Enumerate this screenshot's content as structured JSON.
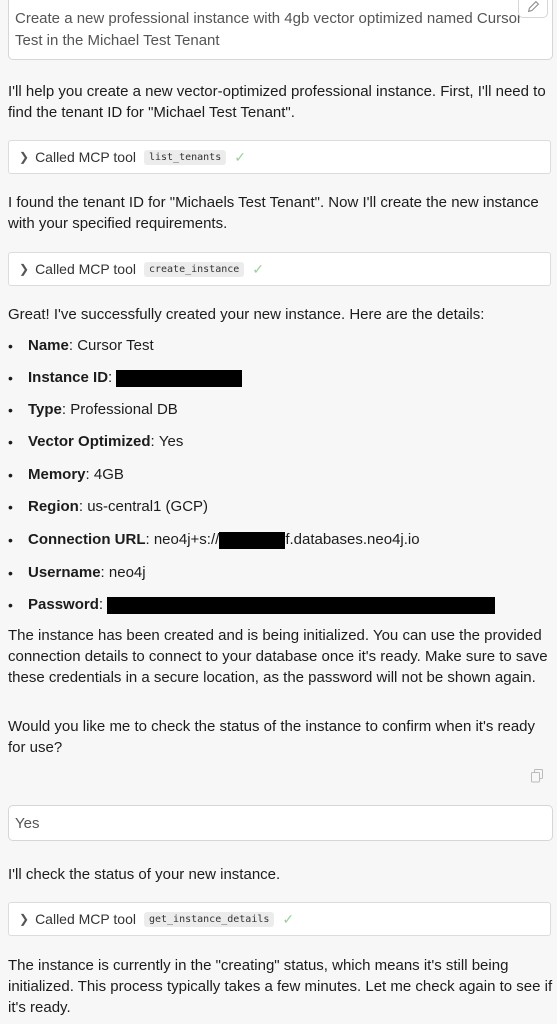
{
  "user_prompt": "Create a new professional instance with 4gb vector optimized named Cursor Test in the Michael Test Tenant",
  "assistant": {
    "intro": "I'll help you create a new vector-optimized professional instance. First, I'll need to find the tenant ID for \"Michael Test Tenant\".",
    "tool1": {
      "prefix": "Called MCP tool",
      "name": "list_tenants"
    },
    "found_tenant": "I found the tenant ID for \"Michaels Test Tenant\". Now I'll create the new instance with your specified requirements.",
    "tool2": {
      "prefix": "Called MCP tool",
      "name": "create_instance"
    },
    "success": "Great! I've successfully created your new instance. Here are the details:",
    "details": [
      {
        "label": "Name",
        "value": "Cursor Test"
      },
      {
        "label": "Instance ID",
        "value": ""
      },
      {
        "label": "Type",
        "value": "Professional DB"
      },
      {
        "label": "Vector Optimized",
        "value": "Yes"
      },
      {
        "label": "Memory",
        "value": "4GB"
      },
      {
        "label": "Region",
        "value": "us-central1 (GCP)"
      },
      {
        "label": "Connection URL",
        "value_prefix": "neo4j+s://",
        "value_suffix": "f.databases.neo4j.io"
      },
      {
        "label": "Username",
        "value": "neo4j"
      },
      {
        "label": "Password",
        "value": ""
      }
    ],
    "created_note": "The instance has been created and is being initialized. You can use the provided connection details to connect to your database once it's ready. Make sure to save these credentials in a secure location, as the password will not be shown again.",
    "question": "Would you like me to check the status of the instance to confirm when it's ready for use?"
  },
  "user_reply": "Yes",
  "assistant2": {
    "check_status": "I'll check the status of your new instance.",
    "tool3": {
      "prefix": "Called MCP tool",
      "name": "get_instance_details"
    },
    "status_note": "The instance is currently in the \"creating\" status, which means it's still being initialized. This process typically takes a few minutes. Let me check again to see if it's ready."
  },
  "icons": {
    "edit": "pencil-icon",
    "expand": "chevron-right-icon",
    "done": "checkmark-icon",
    "copy": "copy-icon"
  }
}
